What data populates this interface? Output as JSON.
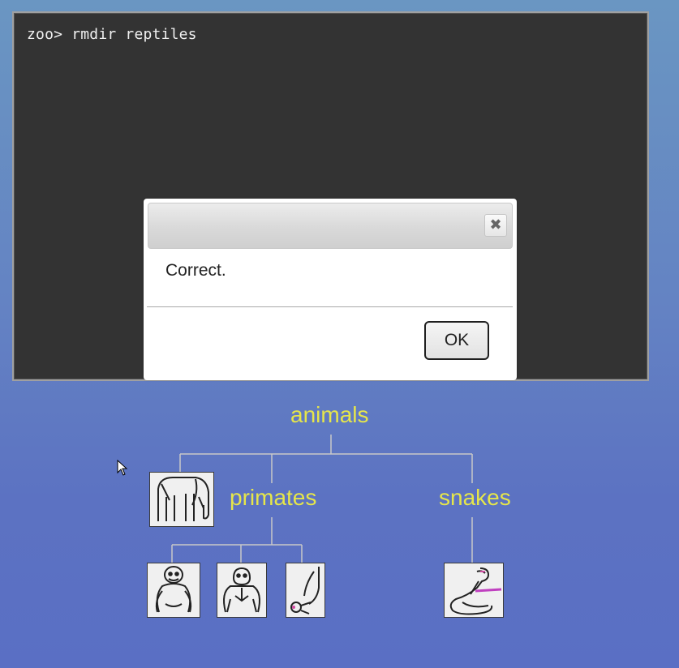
{
  "terminal": {
    "prompt": "zoo>",
    "command": "rmdir reptiles"
  },
  "dialog": {
    "message": "Correct.",
    "ok_label": "OK",
    "close_icon": "close-icon"
  },
  "tree": {
    "root": "animals",
    "children": [
      "primates",
      "snakes"
    ],
    "leaf_icons": [
      "elephant-icon",
      "orangutan-icon",
      "gorilla-icon",
      "monkey-icon",
      "cobra-icon"
    ],
    "label_color": "#e6e64a",
    "line_color": "#c8c8c8"
  }
}
